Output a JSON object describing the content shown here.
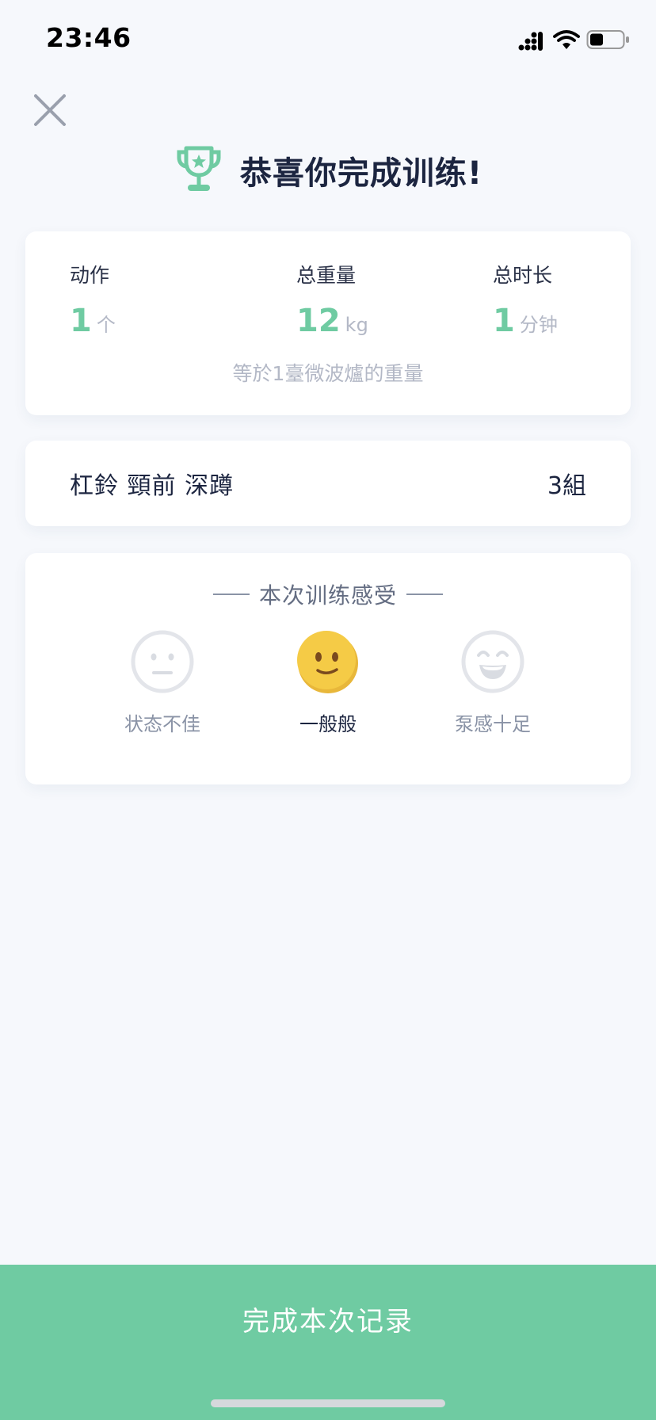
{
  "status_bar": {
    "time": "23:46",
    "icons": [
      "signal-icon",
      "wifi-icon",
      "battery-icon"
    ]
  },
  "header": {
    "close_icon": "close-icon",
    "trophy_icon": "trophy-icon",
    "title": "恭喜你完成训练!"
  },
  "stats": {
    "actions": {
      "label": "动作",
      "value": "1",
      "unit": "个"
    },
    "total_weight": {
      "label": "总重量",
      "value": "12",
      "unit": "kg"
    },
    "total_duration": {
      "label": "总时长",
      "value": "1",
      "unit": "分钟"
    },
    "note": "等於1臺微波爐的重量"
  },
  "exercise": {
    "name": "杠鈴 頸前 深蹲",
    "sets": "3組"
  },
  "feeling": {
    "title": "本次训练感受",
    "options": [
      {
        "label": "状态不佳",
        "icon": "sad-face-icon",
        "selected": false
      },
      {
        "label": "一般般",
        "icon": "smile-face-icon",
        "selected": true
      },
      {
        "label": "泵感十足",
        "icon": "grin-face-icon",
        "selected": false
      }
    ]
  },
  "footer": {
    "finish_label": "完成本次记录"
  },
  "colors": {
    "accent": "#6fcba2",
    "background": "#f6f8fc",
    "title_text": "#1c2540",
    "muted_text": "#b3b8c6",
    "mood_selected": "#f5cb46"
  }
}
